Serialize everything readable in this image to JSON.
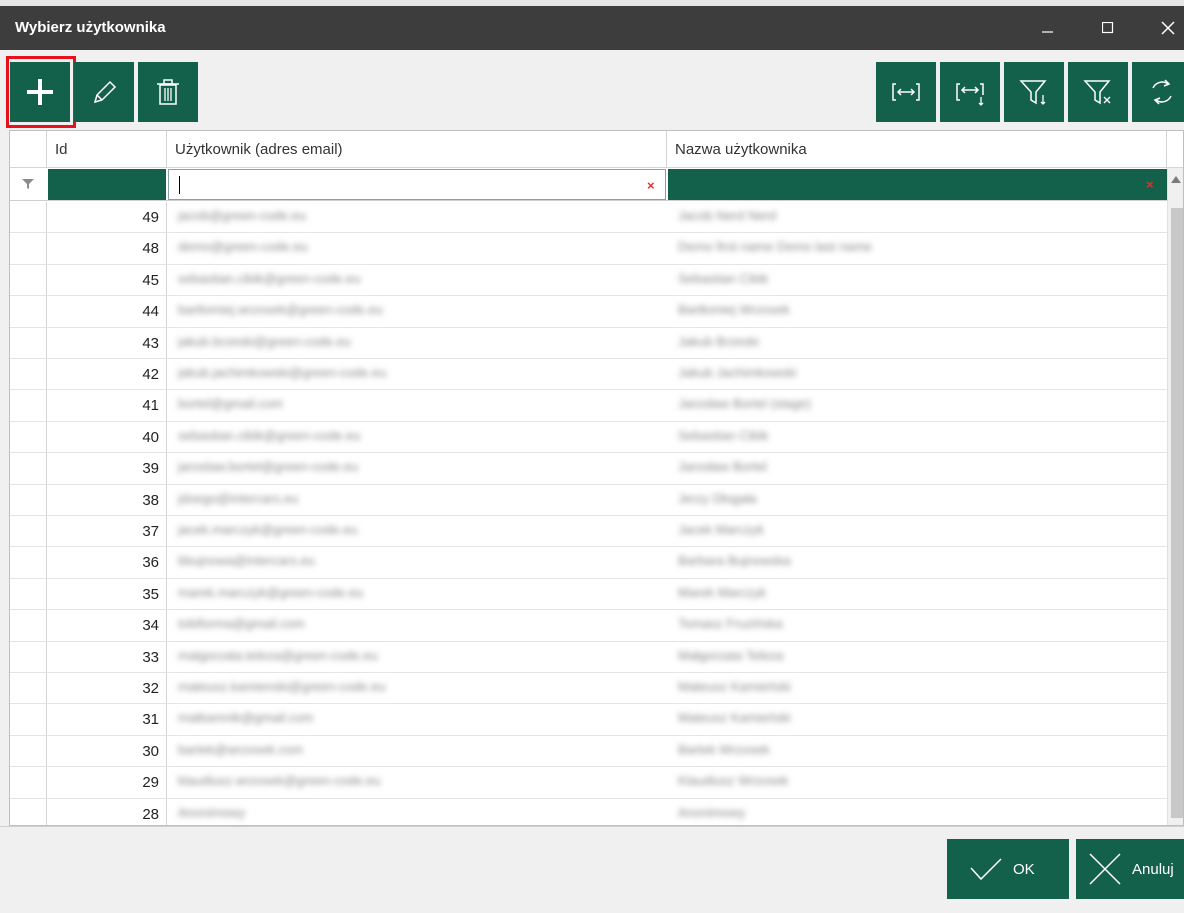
{
  "window": {
    "title": "Wybierz użytkownika"
  },
  "toolbar": {
    "left_buttons": [
      "add-icon",
      "edit-pencil-icon",
      "delete-trash-icon"
    ],
    "right_buttons": [
      "best-fit-columns-icon",
      "best-fit-all-icon",
      "filter-apply-icon",
      "filter-clear-icon",
      "refresh-icon"
    ]
  },
  "grid": {
    "columns": {
      "id": "Id",
      "email": "Użytkownik (adres email)",
      "name": "Nazwa użytkownika"
    },
    "filter": {
      "email_value": "",
      "clear_symbol": "×"
    },
    "rows": [
      {
        "id": "49",
        "email": "jacob@green-code.eu",
        "name": "Jacob Nerd Nerd"
      },
      {
        "id": "48",
        "email": "demo@green-code.eu",
        "name": "Demo first name Demo last name"
      },
      {
        "id": "45",
        "email": "sebastian.cibik@green-code.eu",
        "name": "Sebastian Cibik"
      },
      {
        "id": "44",
        "email": "bartlomiej.wrzosek@green-code.eu",
        "name": "Bartłomiej Wrzosek"
      },
      {
        "id": "43",
        "email": "jakub.brzeski@green-code.eu",
        "name": "Jakub Brzeski"
      },
      {
        "id": "42",
        "email": "jakub.jachimkowski@green-code.eu",
        "name": "Jakub Jachimkowski"
      },
      {
        "id": "41",
        "email": "bortel@gmail.com",
        "name": "Jarosław Bortel (stage)"
      },
      {
        "id": "40",
        "email": "sebastian.cibik@green-code.eu",
        "name": "Sebastian Cibik"
      },
      {
        "id": "39",
        "email": "jaroslaw.bortel@green-code.eu",
        "name": "Jarosław Bortel"
      },
      {
        "id": "38",
        "email": "jdoego@intercars.eu",
        "name": "Jerzy Dłogała"
      },
      {
        "id": "37",
        "email": "jacek.marczyk@green-code.eu",
        "name": "Jacek Marczyk"
      },
      {
        "id": "36",
        "email": "bbujnowa@intercars.eu",
        "name": "Barbara Bujnowska"
      },
      {
        "id": "35",
        "email": "marek.marczyk@green-code.eu",
        "name": "Marek Marczyk"
      },
      {
        "id": "34",
        "email": "tobiforma@gmail.com",
        "name": "Tomasz Fruzińska"
      },
      {
        "id": "33",
        "email": "malgorzata.teleza@green-code.eu",
        "name": "Małgorzata Teleza"
      },
      {
        "id": "32",
        "email": "mateusz.kamienski@green-code.eu",
        "name": "Mateusz Kamieński"
      },
      {
        "id": "31",
        "email": "matkamnik@gmail.com",
        "name": "Mateusz Kamieński"
      },
      {
        "id": "30",
        "email": "bartek@wrzosek.com",
        "name": "Bartek Wrzosek"
      },
      {
        "id": "29",
        "email": "klaudiusz.wrzosek@green-code.eu",
        "name": "Klaudiusz Wrzosek"
      },
      {
        "id": "28",
        "email": "Anonimowy",
        "name": "Anonimowy"
      }
    ]
  },
  "footer": {
    "ok_label": "OK",
    "cancel_label": "Anuluj"
  },
  "colors": {
    "accent": "#13604b",
    "titlebar": "#3d3d3d",
    "highlight": "#e8121c"
  }
}
